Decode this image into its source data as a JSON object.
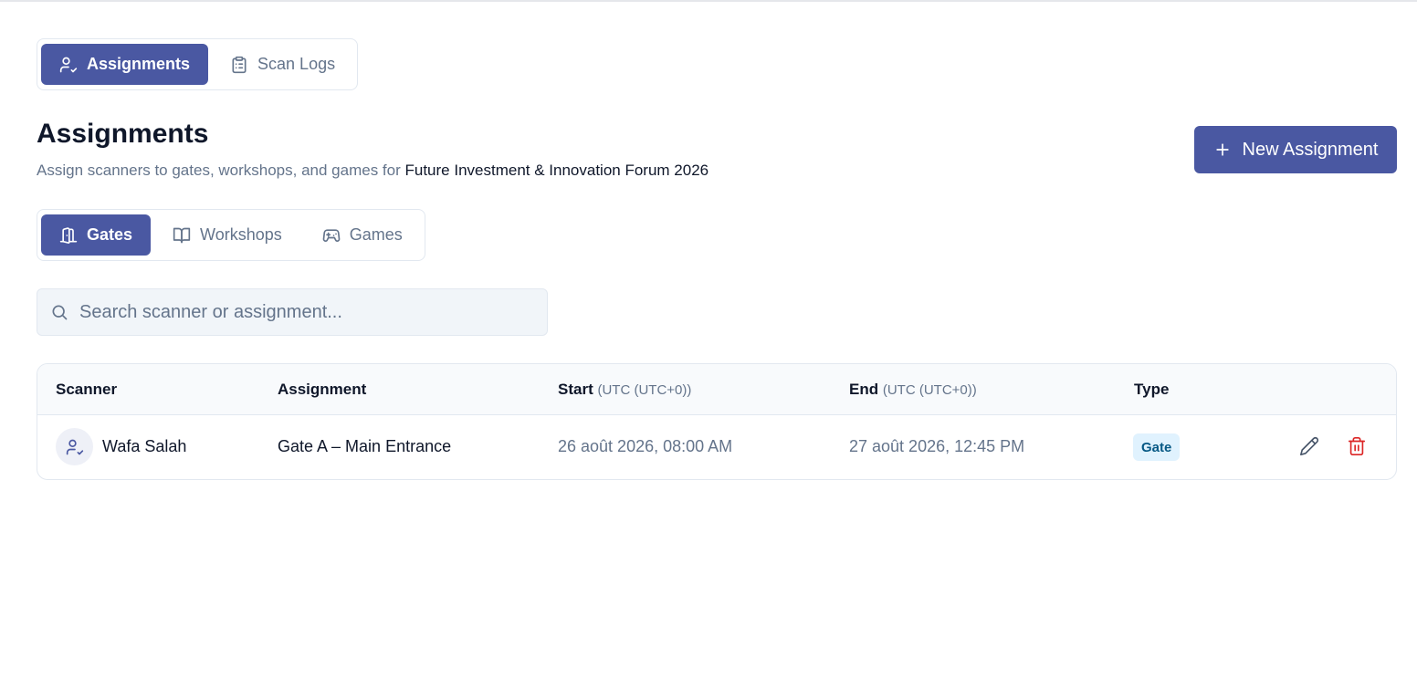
{
  "main_tabs": {
    "assignments_label": "Assignments",
    "scan_logs_label": "Scan Logs",
    "active": "assignments"
  },
  "header": {
    "title": "Assignments",
    "subtitle_prefix": "Assign scanners to gates, workshops, and games for",
    "event_name": "Future Investment & Innovation Forum 2026",
    "new_button_label": "New Assignment"
  },
  "sub_tabs": {
    "gates_label": "Gates",
    "workshops_label": "Workshops",
    "games_label": "Games",
    "active": "gates"
  },
  "search": {
    "placeholder": "Search scanner or assignment...",
    "value": ""
  },
  "table": {
    "columns": {
      "scanner": "Scanner",
      "assignment": "Assignment",
      "start": "Start",
      "start_tz": "(UTC (UTC+0))",
      "end": "End",
      "end_tz": "(UTC (UTC+0))",
      "type": "Type"
    },
    "rows": [
      {
        "scanner": "Wafa Salah",
        "assignment": "Gate A – Main Entrance",
        "start": "26 août 2026, 08:00 AM",
        "end": "27 août 2026, 12:45 PM",
        "type": "Gate"
      }
    ]
  },
  "colors": {
    "accent": "#4a58a2",
    "badge_bg": "#e0f2fe",
    "badge_text": "#075985",
    "delete": "#dc2626",
    "muted_text": "#64748b"
  },
  "icons": {
    "assignments_tab": "user-check-icon",
    "scan_logs_tab": "clipboard-list-icon",
    "new_assignment": "plus-icon",
    "gates_tab": "door-open-icon",
    "workshops_tab": "book-open-icon",
    "games_tab": "gamepad-icon",
    "search": "search-icon",
    "avatar": "user-check-icon",
    "edit": "pencil-icon",
    "delete": "trash-icon"
  }
}
